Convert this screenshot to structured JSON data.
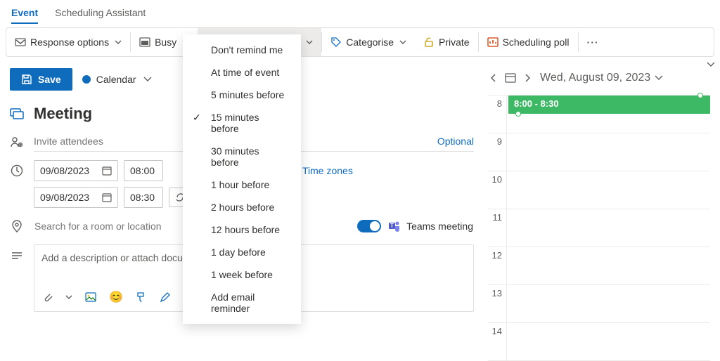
{
  "tabs": {
    "event": "Event",
    "scheduling": "Scheduling Assistant"
  },
  "toolbar": {
    "response": "Response options",
    "busy": "Busy",
    "reminder": "15 minutes before",
    "categorise": "Categorise",
    "private": "Private",
    "poll": "Scheduling poll"
  },
  "reminder_options": [
    "Don't remind me",
    "At time of event",
    "5 minutes before",
    "15 minutes before",
    "30 minutes before",
    "1 hour before",
    "2 hours before",
    "12 hours before",
    "1 day before",
    "1 week before",
    "Add email reminder"
  ],
  "reminder_selected_index": 3,
  "save": "Save",
  "calendar_label": "Calendar",
  "event_title": "Meeting",
  "invite_placeholder": "Invite attendees",
  "optional": "Optional",
  "start_date": "09/08/2023",
  "start_time": "08:00",
  "end_date": "09/08/2023",
  "end_time": "08:30",
  "timezones": "Time zones",
  "location_placeholder": "Search for a room or location",
  "teams_label": "Teams meeting",
  "desc_placeholder": "Add a description or attach docu",
  "right": {
    "date": "Wed, August 09, 2023",
    "hours": [
      "8",
      "9",
      "10",
      "11",
      "12",
      "13",
      "14"
    ],
    "event_label": "8:00 - 8:30"
  }
}
